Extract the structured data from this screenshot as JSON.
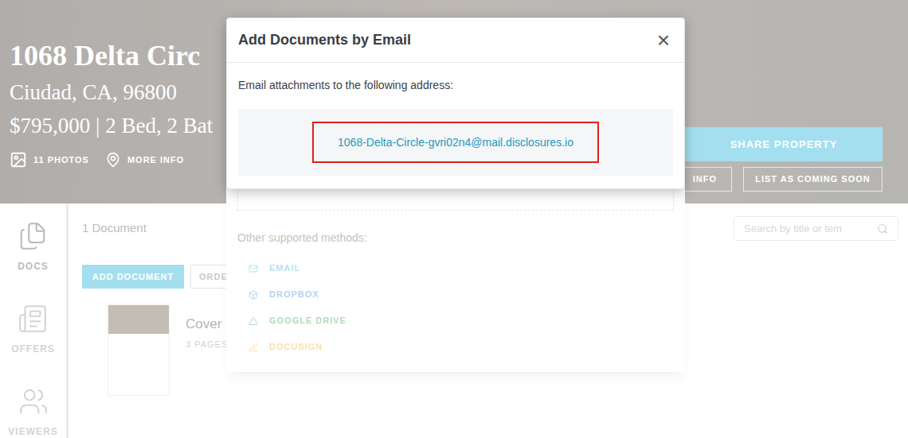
{
  "property": {
    "title": "1068 Delta Circ",
    "address": "Ciudad, CA, 96800",
    "summary": "$795,000 | 2 Bed, 2 Bat",
    "photos": "11 PHOTOS",
    "more_info": "MORE INFO",
    "buttons": [
      "SHARE PROPERTY",
      "INFO",
      "LIST AS COMING SOON"
    ]
  },
  "sidebar": {
    "items": [
      {
        "label": "DOCS",
        "selected": true
      },
      {
        "label": "OFFERS",
        "selected": false
      },
      {
        "label": "VIEWERS",
        "selected": false
      }
    ]
  },
  "documents": {
    "count": "1 Document",
    "buttons": [
      "ADD DOCUMENT",
      "ORDE"
    ],
    "search": {
      "placeholder": "Search by title or tem"
    },
    "items": [
      {
        "title": "Cover",
        "pages": "3 PAGES"
      }
    ]
  },
  "upload_dialog": {
    "methods_label": "Other supported methods:",
    "methods": [
      {
        "label": "EMAIL",
        "color": "#4fb3d9"
      },
      {
        "label": "DROPBOX",
        "color": "#3d8fd6"
      },
      {
        "label": "GOOGLE DRIVE",
        "color": "#34a853"
      },
      {
        "label": "DOCUSIGN",
        "color": "#f2b233"
      }
    ]
  },
  "modal": {
    "title": "Add Documents by Email",
    "close": "×",
    "instruction": "Email attachments to the following address:",
    "email": "1068-Delta-Circle-gvri02n4@mail.disclosures.io"
  }
}
